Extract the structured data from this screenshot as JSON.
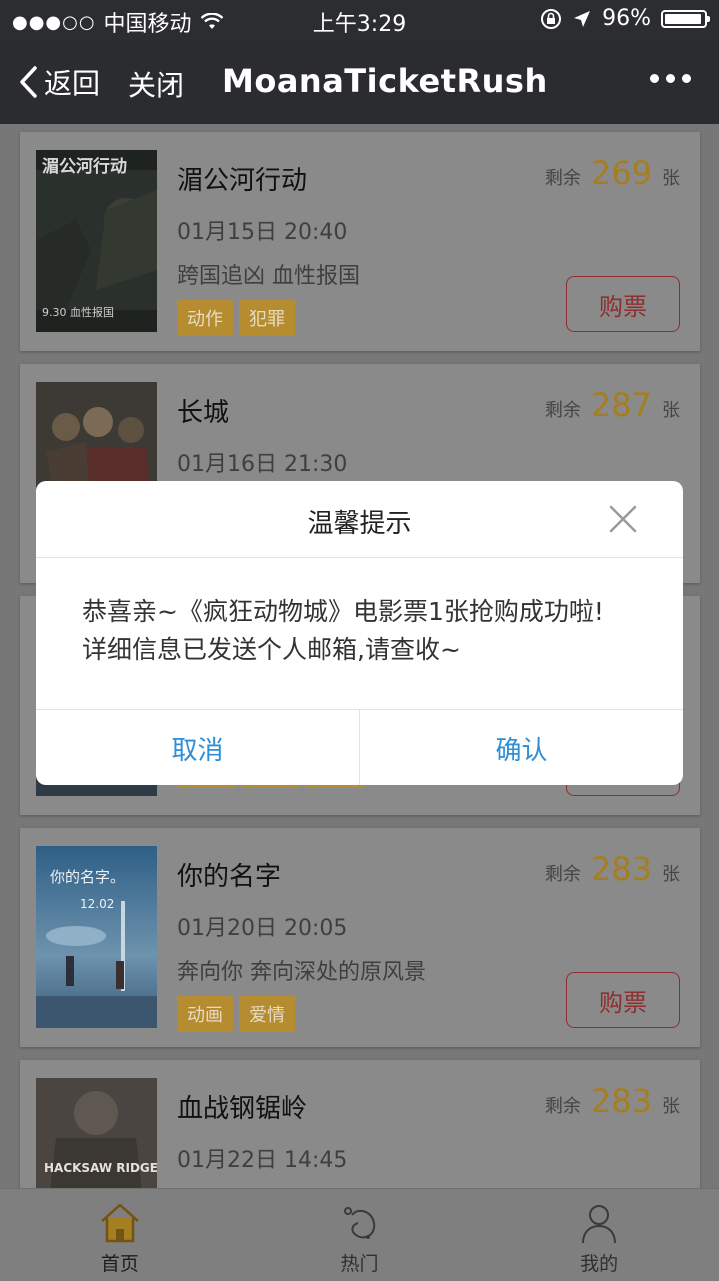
{
  "status": {
    "carrier": "中国移动",
    "time": "上午3:29",
    "battery": "96%",
    "battery_level": 0.96
  },
  "nav": {
    "back": "返回",
    "close": "关闭",
    "title": "MoanaTicketRush"
  },
  "movies": [
    {
      "name": "湄公河行动",
      "time": "01月15日 20:40",
      "slogan": "跨国追凶 血性报国",
      "tags": [
        "动作",
        "犯罪"
      ],
      "remain_label": "剩余",
      "remain": "269",
      "unit": "张",
      "buy": "购票",
      "poster_title": "湄公河行动",
      "poster_sub": "9.30 血性报国"
    },
    {
      "name": "长城",
      "time": "01月16日 21:30",
      "remain_label": "剩余",
      "remain": "287",
      "unit": "张"
    },
    {
      "name": "你的名字",
      "time": "01月20日 20:05",
      "slogan": "奔向你 奔向深处的原风景",
      "tags": [
        "动画",
        "爱情"
      ],
      "remain_label": "剩余",
      "remain": "283",
      "unit": "张",
      "buy": "购票",
      "poster_title": "你的名字。",
      "poster_sub": "12.02"
    },
    {
      "name": "血战钢锯岭",
      "time": "01月22日 14:45",
      "remain_label": "剩余",
      "remain": "283",
      "unit": "张",
      "poster_title": "HACKSAW RIDGE"
    }
  ],
  "dialog": {
    "title": "温馨提示",
    "message_line1": "恭喜亲~《疯狂动物城》电影票1张抢购成功啦!",
    "message_line2": "详细信息已发送个人邮箱,请查收~",
    "cancel": "取消",
    "confirm": "确认"
  },
  "tabs": [
    {
      "label": "首页",
      "icon": "home-icon"
    },
    {
      "label": "热门",
      "icon": "hot-icon"
    },
    {
      "label": "我的",
      "icon": "profile-icon"
    }
  ]
}
